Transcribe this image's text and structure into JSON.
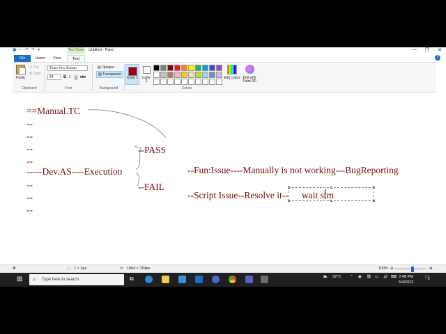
{
  "window": {
    "title": "Untitled - Paint",
    "context_tab": "Text Tools",
    "controls": {
      "minimize": "—",
      "maximize": "❐",
      "close": "✕"
    }
  },
  "tabs": {
    "file": "File",
    "home": "Home",
    "view": "View",
    "text": "Text"
  },
  "ribbon": {
    "clipboard": {
      "paste": "Paste",
      "cut": "Cut",
      "copy": "Copy",
      "label": "Clipboard"
    },
    "font": {
      "family": "Times New Roman",
      "size": "24",
      "bold": "B",
      "italic": "I",
      "underline": "U",
      "strike": "abc",
      "label": "Font"
    },
    "background": {
      "opaque": "Opaque",
      "transparent": "Transparent",
      "label": "Background"
    },
    "colors": {
      "color1_label": "Color 1",
      "color2_label": "Color 2",
      "edit_colors": "Edit colors",
      "edit_paint3d": "Edit with Paint 3D",
      "label": "Colors",
      "color1": "#990012",
      "color2": "#ffffff",
      "palette": [
        "#000000",
        "#7f7f7f",
        "#880015",
        "#ed1c24",
        "#ff7f27",
        "#fff200",
        "#22b14c",
        "#00a2e8",
        "#3f48cc",
        "#a349a4",
        "#ffffff",
        "#c3c3c3",
        "#b97a57",
        "#ffaec9",
        "#ffc90e",
        "#efe4b0",
        "#b5e61d",
        "#99d9ea",
        "#7092be",
        "#c8bfe7",
        "#ffffff",
        "#ffffff",
        "#ffffff",
        "#ffffff",
        "#ffffff",
        "#ffffff",
        "#ffffff",
        "#ffffff",
        "#ffffff",
        "#ffffff"
      ]
    }
  },
  "canvas": {
    "text_color": "#7a0c0c",
    "lines": [
      "==Manual.TC",
      "--",
      "--",
      "--",
      "--",
      "-----Dev.AS----Execution",
      "--",
      "--",
      "--"
    ],
    "pass": "--PASS",
    "fail": "--FAIL",
    "fun_issue": "--Fun:Issue----Manually is not working---BugReporting",
    "script_issue": "--Script Issue--Resolve it--",
    "typing": "wait stm"
  },
  "statusbar": {
    "selection_size": "1 × 1px",
    "canvas_size": "1904 × 764px",
    "zoom": "100%"
  },
  "taskbar": {
    "search_placeholder": "Type here to search",
    "weather": "32°C",
    "time": "2:48 PM",
    "date": "5/4/2023",
    "notifications": "2"
  }
}
